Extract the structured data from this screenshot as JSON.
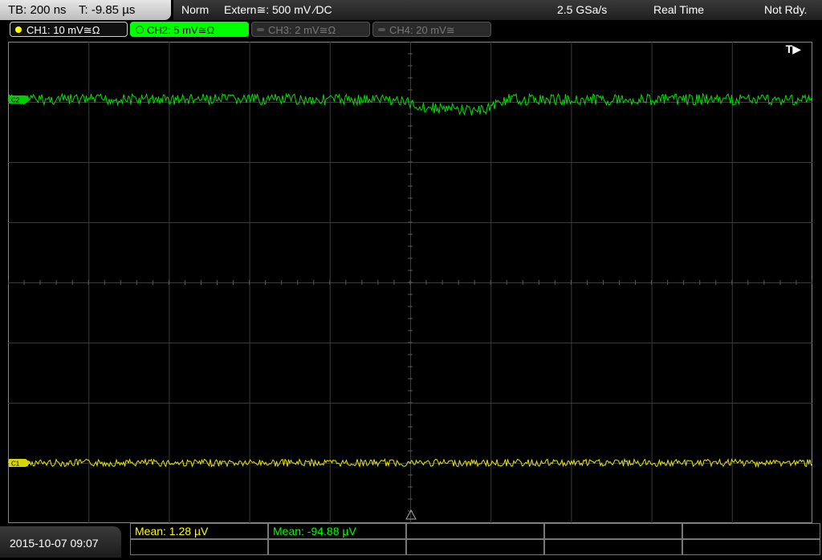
{
  "topbar": {
    "timebase": "TB: 200 ns",
    "trigger_time": "T: -9.85 µs",
    "mode": "Norm",
    "trigger_source": "Extern≅: 500 mV ⁄DC",
    "sample_rate": "2.5 GSa/s",
    "acq_mode": "Real Time",
    "status": "Not Rdy."
  },
  "channels": [
    {
      "label": "CH1: 10 mV≅Ω",
      "color": "#ffff00",
      "active": true
    },
    {
      "label": "CH2: 5 mV≅Ω",
      "color": "#00ff00",
      "active": true,
      "selected": true
    },
    {
      "label": "CH3: 2 mV≅Ω",
      "color": "#777777",
      "active": false
    },
    {
      "label": "CH4: 20 mV≅",
      "color": "#777777",
      "active": false
    }
  ],
  "screen": {
    "trigger_marker": "T▶",
    "ch2_marker": "C2",
    "ch1_marker": "C1"
  },
  "measurements": [
    {
      "label": "Mean: 1.28 µV",
      "color": "#ffff00"
    },
    {
      "label": "Mean: -94.88 µV",
      "color": "#00ff00"
    }
  ],
  "datetime": "2015-10-07 09:07"
}
